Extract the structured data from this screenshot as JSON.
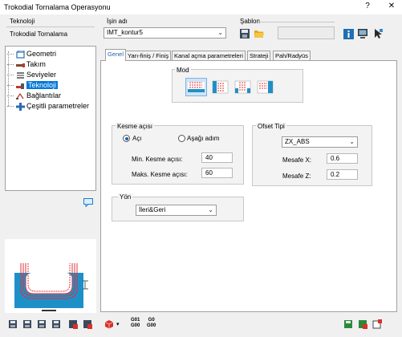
{
  "window": {
    "title": "Trokodial Tornalama Operasyonu",
    "help_glyph": "?",
    "close_glyph": "✕"
  },
  "header": {
    "teknoloji_label": "Teknoloji",
    "teknoloji_value": "Trokodial Tornalama",
    "isin_adi_label": "İşin adı",
    "isin_adi_value": "IMT_kontur5",
    "sablon_label": "Şablon"
  },
  "tree": {
    "items": [
      {
        "label": "Geometri"
      },
      {
        "label": "Takım"
      },
      {
        "label": "Seviyeler"
      },
      {
        "label": "Teknoloji"
      },
      {
        "label": "Bağlantılar"
      },
      {
        "label": "Çeşitli parametreler"
      }
    ]
  },
  "tabs": [
    {
      "label": "Genel"
    },
    {
      "label": "Yarı-finiş / Finiş"
    },
    {
      "label": "Kanal açma parametreleri"
    },
    {
      "label": "Strateji"
    },
    {
      "label": "Pah/Radyüs"
    }
  ],
  "mod": {
    "label": "Mod"
  },
  "kesme": {
    "title": "Kesme açısı",
    "option_aci": "Açı",
    "option_asagi": "Aşağı adım",
    "min_label": "Min. Kesme açısı:",
    "min_value": "40",
    "maks_label": "Maks. Kesme açısı:",
    "maks_value": "60"
  },
  "ofset": {
    "title": "Ofset Tipi",
    "type_value": "ZX_ABS",
    "mesafe_x_label": "Mesafe X:",
    "mesafe_x_value": "0.6",
    "mesafe_z_label": "Mesafe Z:",
    "mesafe_z_value": "0.2"
  },
  "yon": {
    "title": "Yön",
    "value": "İleri&Geri"
  },
  "toolbar": {
    "g01_top": "G01",
    "g01_bottom": "G00",
    "g0_top": "G0",
    "g0_bottom": "G00"
  },
  "colors": {
    "accent": "#0078d7",
    "tab_active_text": "#1a5fb4",
    "preview_blue": "#1e90c8",
    "preview_red": "#e0303a"
  }
}
